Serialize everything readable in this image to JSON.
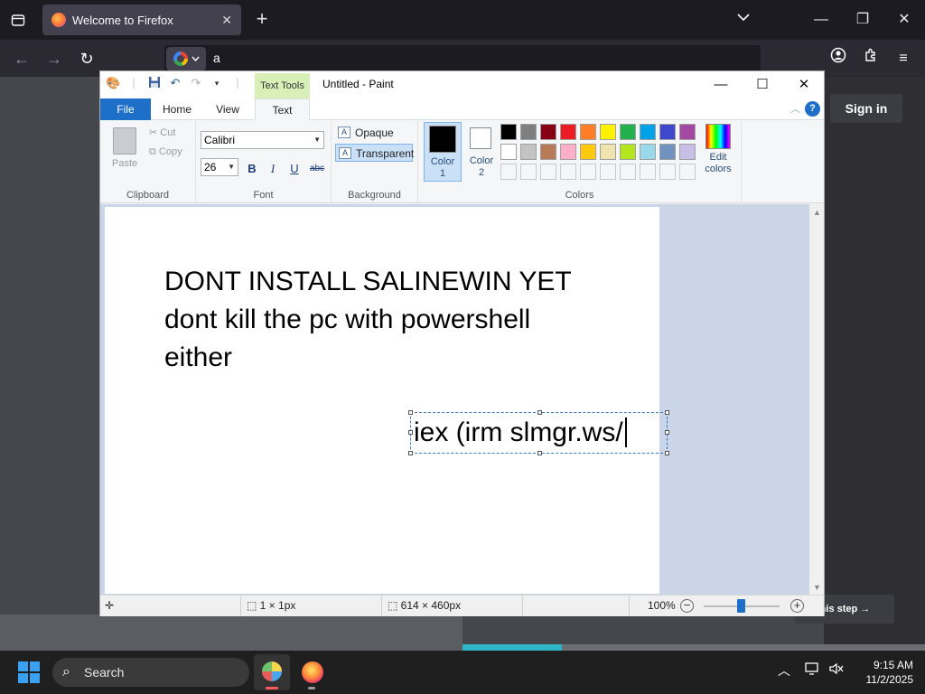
{
  "firefox": {
    "tab_title": "Welcome to Firefox",
    "address_value": "a",
    "signin_label": "Sign in",
    "step_label": "this step"
  },
  "paint": {
    "window_title": "Untitled - Paint",
    "contextual_tab": "Text Tools",
    "tabs": [
      "File",
      "Home",
      "View",
      "Text"
    ],
    "clipboard": {
      "paste": "Paste",
      "cut": "Cut",
      "copy": "Copy",
      "label": "Clipboard"
    },
    "font": {
      "family": "Calibri",
      "size": "26",
      "label": "Font",
      "bold": "B",
      "italic": "I",
      "underline": "U",
      "strike": "abc"
    },
    "background": {
      "opaque": "Opaque",
      "transparent": "Transparent",
      "label": "Background"
    },
    "colors": {
      "color1_label": "Color\n1",
      "color2_label": "Color\n2",
      "edit_label": "Edit colors",
      "group_label": "Colors",
      "color1": "#000000",
      "color2": "#ffffff",
      "palette_row1": [
        "#000000",
        "#7f7f7f",
        "#880015",
        "#ed1c24",
        "#ff7f27",
        "#fff200",
        "#22b14c",
        "#00a2e8",
        "#3f48cc",
        "#a349a4"
      ],
      "palette_row2": [
        "#ffffff",
        "#c3c3c3",
        "#b97a57",
        "#ffaec9",
        "#ffc90e",
        "#efe4b0",
        "#b5e61d",
        "#99d9ea",
        "#7092be",
        "#c8bfe7"
      ],
      "palette_row3": [
        "#f5f6f7",
        "#f5f6f7",
        "#f5f6f7",
        "#f5f6f7",
        "#f5f6f7",
        "#f5f6f7",
        "#f5f6f7",
        "#f5f6f7",
        "#f5f6f7",
        "#f5f6f7"
      ]
    },
    "canvas_lines": [
      "DONT INSTALL SALINEWIN YET",
      "dont kill the pc with powershell",
      "either"
    ],
    "textbox_value": "iex (irm slmgr.ws/",
    "status": {
      "selection": "1 × 1px",
      "size": "614 × 460px",
      "zoom": "100%"
    }
  },
  "taskbar": {
    "search_placeholder": "Search",
    "time": "9:15 AM",
    "date": "11/2/2025"
  }
}
